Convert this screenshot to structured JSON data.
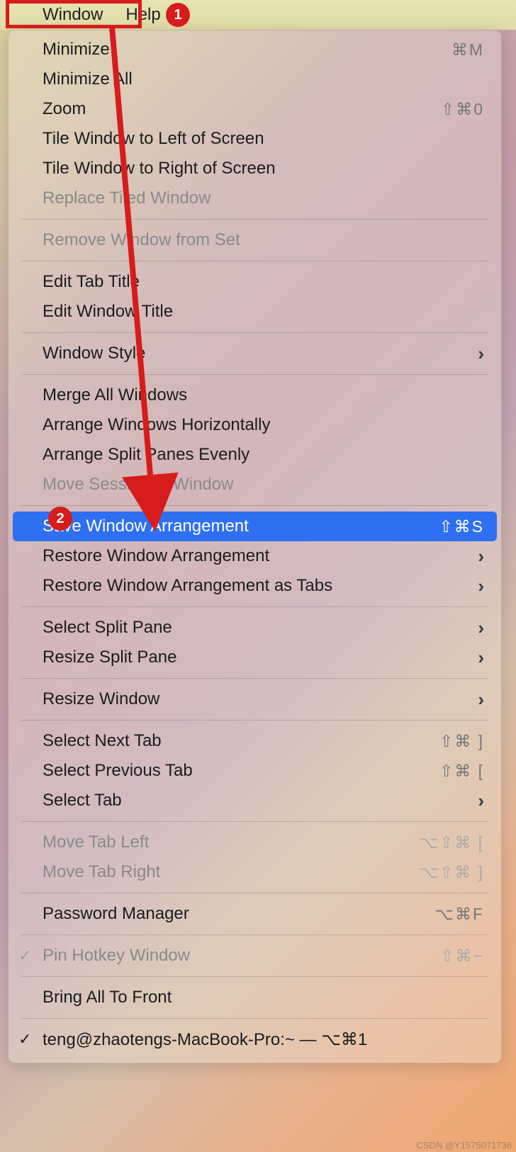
{
  "menubar": {
    "window": "Window",
    "help": "Help"
  },
  "annotations": {
    "one": "1",
    "two": "2"
  },
  "menu": {
    "minimize": {
      "label": "Minimize",
      "accel": "⌘M"
    },
    "minimize_all": {
      "label": "Minimize All",
      "accel": ""
    },
    "zoom": {
      "label": "Zoom",
      "accel": "⇧⌘0"
    },
    "tile_left": {
      "label": "Tile Window to Left of Screen",
      "accel": ""
    },
    "tile_right": {
      "label": "Tile Window to Right of Screen",
      "accel": ""
    },
    "replace_tiled": {
      "label": "Replace Tiled Window",
      "accel": ""
    },
    "remove_from_set": {
      "label": "Remove Window from Set",
      "accel": ""
    },
    "edit_tab_title": {
      "label": "Edit Tab Title",
      "accel": ""
    },
    "edit_window_title": {
      "label": "Edit Window Title",
      "accel": ""
    },
    "window_style": {
      "label": "Window Style",
      "accel": ""
    },
    "merge_all": {
      "label": "Merge All Windows",
      "accel": ""
    },
    "arrange_horiz": {
      "label": "Arrange Windows Horizontally",
      "accel": ""
    },
    "arrange_split": {
      "label": "Arrange Split Panes Evenly",
      "accel": ""
    },
    "move_session": {
      "label": "Move Session to Window",
      "accel": ""
    },
    "save_arrangement": {
      "label": "Save Window Arrangement",
      "accel": "⇧⌘S"
    },
    "restore_arrange": {
      "label": "Restore Window Arrangement",
      "accel": ""
    },
    "restore_tabs": {
      "label": "Restore Window Arrangement as Tabs",
      "accel": ""
    },
    "select_split_pane": {
      "label": "Select Split Pane",
      "accel": ""
    },
    "resize_split_pane": {
      "label": "Resize Split Pane",
      "accel": ""
    },
    "resize_window": {
      "label": "Resize Window",
      "accel": ""
    },
    "select_next_tab": {
      "label": "Select Next Tab",
      "accel": "⇧⌘ ]"
    },
    "select_prev_tab": {
      "label": "Select Previous Tab",
      "accel": "⇧⌘ ["
    },
    "select_tab": {
      "label": "Select Tab",
      "accel": ""
    },
    "move_tab_left": {
      "label": "Move Tab Left",
      "accel": "⌥⇧⌘ ["
    },
    "move_tab_right": {
      "label": "Move Tab Right",
      "accel": "⌥⇧⌘ ]"
    },
    "password_manager": {
      "label": "Password Manager",
      "accel": "⌥⌘F"
    },
    "pin_hotkey": {
      "label": "Pin Hotkey Window",
      "accel": "⇧⌘−"
    },
    "bring_to_front": {
      "label": "Bring All To Front",
      "accel": ""
    },
    "session": {
      "label": "teng@zhaotengs-MacBook-Pro:~ — ⌥⌘1",
      "accel": ""
    }
  },
  "watermark": "CSDN @Y1575071736"
}
